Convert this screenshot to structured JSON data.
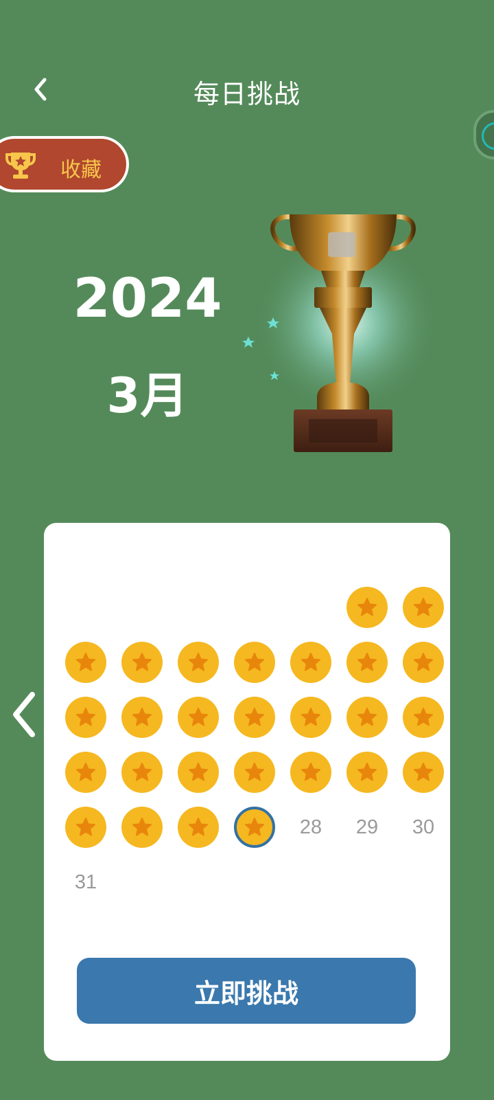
{
  "header": {
    "title": "每日挑战",
    "back_icon": "chevron-left-icon"
  },
  "collect": {
    "label": "收藏",
    "icon": "trophy-icon"
  },
  "period": {
    "year": "2024",
    "month": "3月"
  },
  "calendar": {
    "leading_blanks": 5,
    "days": [
      {
        "day": "1",
        "completed": true
      },
      {
        "day": "2",
        "completed": true
      },
      {
        "day": "3",
        "completed": true
      },
      {
        "day": "4",
        "completed": true
      },
      {
        "day": "5",
        "completed": true
      },
      {
        "day": "6",
        "completed": true
      },
      {
        "day": "7",
        "completed": true
      },
      {
        "day": "8",
        "completed": true
      },
      {
        "day": "9",
        "completed": true
      },
      {
        "day": "10",
        "completed": true
      },
      {
        "day": "11",
        "completed": true
      },
      {
        "day": "12",
        "completed": true
      },
      {
        "day": "13",
        "completed": true
      },
      {
        "day": "14",
        "completed": true
      },
      {
        "day": "15",
        "completed": true
      },
      {
        "day": "16",
        "completed": true
      },
      {
        "day": "17",
        "completed": true
      },
      {
        "day": "18",
        "completed": true
      },
      {
        "day": "19",
        "completed": true
      },
      {
        "day": "20",
        "completed": true
      },
      {
        "day": "21",
        "completed": true
      },
      {
        "day": "22",
        "completed": true
      },
      {
        "day": "23",
        "completed": true
      },
      {
        "day": "24",
        "completed": true
      },
      {
        "day": "25",
        "completed": true
      },
      {
        "day": "26",
        "completed": true
      },
      {
        "day": "27",
        "completed": true,
        "today": true
      },
      {
        "day": "28",
        "completed": false
      },
      {
        "day": "29",
        "completed": false
      },
      {
        "day": "30",
        "completed": false
      },
      {
        "day": "31",
        "completed": false
      }
    ]
  },
  "action": {
    "label": "立即挑战"
  },
  "colors": {
    "background": "#548a5a",
    "coin": "#f5b820",
    "star": "#e8860c",
    "today_ring": "#3571a2",
    "button": "#3a78ad",
    "collect_bg": "#b0472e",
    "collect_text": "#f7c64b"
  }
}
